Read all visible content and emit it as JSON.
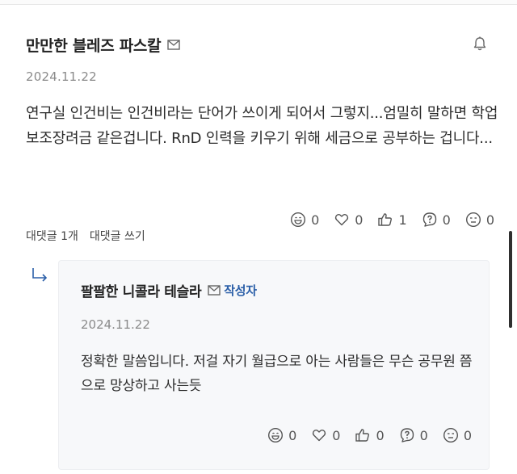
{
  "comment": {
    "author": "만만한 블레즈 파스칼",
    "date": "2024.11.22",
    "text": "연구실 인건비는 인건비라는 단어가 쓰이게 되어서 그렇지...엄밀히 말하면 학업보조장려금 같은겁니다. RnD 인력을 키우기 위해 세금으로 공부하는 겁니다...",
    "reply_count_label": "대댓글 1개",
    "write_reply_label": "대댓글 쓰기",
    "reactions": [
      {
        "icon": "laugh-icon",
        "count": "0"
      },
      {
        "icon": "heart-icon",
        "count": "0"
      },
      {
        "icon": "thumbs-up-icon",
        "count": "1"
      },
      {
        "icon": "question-icon",
        "count": "0"
      },
      {
        "icon": "sad-icon",
        "count": "0"
      }
    ]
  },
  "reply": {
    "author": "팔팔한 니콜라 테슬라",
    "badge": "작성자",
    "date": "2024.11.22",
    "text": "정확한 말씀입니다. 저걸 자기 월급으로 아는 사람들은 무슨 공무원 쯤으로 망상하고 사는듯",
    "reactions": [
      {
        "icon": "laugh-icon",
        "count": "0"
      },
      {
        "icon": "heart-icon",
        "count": "0"
      },
      {
        "icon": "thumbs-up-icon",
        "count": "0"
      },
      {
        "icon": "question-icon",
        "count": "0"
      },
      {
        "icon": "sad-icon",
        "count": "0"
      }
    ]
  },
  "colors": {
    "badge": "#2b5fa8",
    "muted": "#8a8a8a",
    "reply_bg": "#f7f8fa"
  }
}
